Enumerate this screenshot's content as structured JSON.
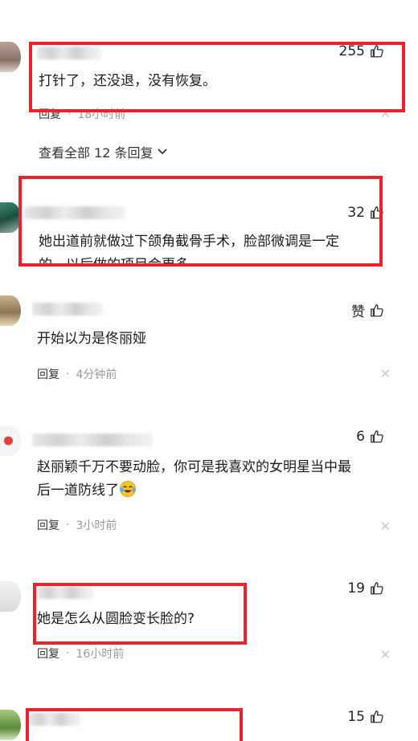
{
  "comments": [
    {
      "likes": "255",
      "text": "打针了，还没退，没有恢复。",
      "reply": "回复",
      "time": "18小时前"
    },
    {
      "view_all": "查看全部 12 条回复"
    },
    {
      "likes": "32",
      "text_line1": "她出道前就做过下颌角截骨手术，脸部微调是一定",
      "text_line2": "的，以后做的项目会更多"
    },
    {
      "likes": "赞",
      "text": "开始以为是佟丽娅",
      "reply": "回复",
      "time": "4分钟前"
    },
    {
      "likes": "6",
      "text_line1": "赵丽颖千万不要动脸，你可是我喜欢的女明星当中最",
      "text_line2": "后一道防线了",
      "reply": "回复",
      "time": "3小时前"
    },
    {
      "likes": "19",
      "text": "她是怎么从圆脸变长脸的?",
      "reply": "回复",
      "time": "16小时前"
    },
    {
      "likes": "15"
    }
  ],
  "separator": "·",
  "colors": {
    "highlight": "#e8232c",
    "muted": "#999999"
  },
  "icons": [
    "thumbs-up-icon",
    "close-icon",
    "chevron-down-icon",
    "crying-laughing-emoji"
  ]
}
